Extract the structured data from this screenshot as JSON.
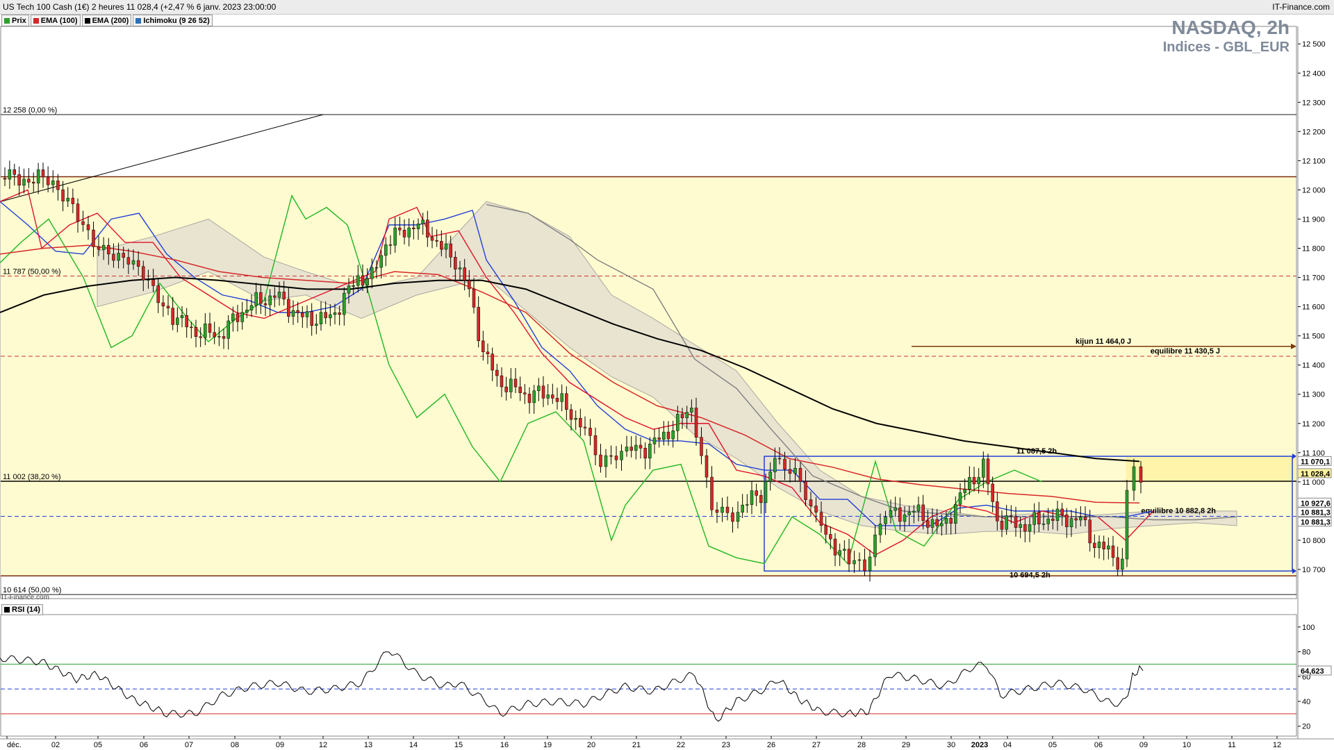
{
  "header": {
    "instrument_line": "US Tech 100 Cash (1€) 2 heures 11 028,4 (+2,47 % 6 janv. 2023 23:00:00",
    "brand": "IT-Finance.com",
    "watermark": "IT-Finance.com"
  },
  "legend": [
    {
      "label": "Prix",
      "color": "#2ca02c"
    },
    {
      "label": "EMA (100)",
      "color": "#d62728"
    },
    {
      "label": "EMA (200)",
      "color": "#000000"
    },
    {
      "label": "Ichimoku (9 26 52)",
      "color": "#2c6fb7"
    }
  ],
  "title": {
    "name": "NASDAQ, 2h",
    "sub": "Indices - GBL_EUR"
  },
  "rsi_label": "RSI (14)",
  "chart_data": [
    {
      "type": "candlestick",
      "title": "NASDAQ, 2h",
      "subtitle": "Indices - GBL_EUR",
      "x_axis_labels": [
        "déc.",
        "02",
        "05",
        "06",
        "07",
        "08",
        "09",
        "12",
        "13",
        "14",
        "15",
        "16",
        "19",
        "20",
        "21",
        "22",
        "23",
        "26",
        "27",
        "28",
        "29",
        "30",
        "2023",
        "04",
        "05",
        "06",
        "09",
        "10",
        "11",
        "12"
      ],
      "y_axis_ticks": [
        10700,
        10800,
        10900,
        11000,
        11100,
        11200,
        11300,
        11400,
        11500,
        11600,
        11700,
        11800,
        11900,
        12000,
        12100,
        12200,
        12300,
        12400,
        12500
      ],
      "y_range": [
        10600,
        12560
      ],
      "axis_tags": [
        {
          "value": 11070.1,
          "text": "11 070,1",
          "color": "#000000"
        },
        {
          "value": 11028.4,
          "text": "11 028,4",
          "color": "#000000",
          "highlight": "#fff3a0"
        },
        {
          "value": 10927.6,
          "text": "10 927,6",
          "color": "#d62728"
        },
        {
          "value": 10881.3,
          "text": "10 881,3",
          "color": "#1f3fd6"
        },
        {
          "value": 10881.3,
          "text": "10 881,3",
          "color": "#d62728"
        }
      ],
      "fibonacci": [
        {
          "value": 12258,
          "text": "12 258 (0,00 %)"
        },
        {
          "value": 11787,
          "text": "11 787 (50,00 %)"
        },
        {
          "value": 11002,
          "text": "11 002 (38,20 %)"
        },
        {
          "value": 10614,
          "text": "10 614 (50,00 %)"
        }
      ],
      "horizontal_levels": [
        {
          "value": 12045,
          "style": "solid",
          "color": "#7a2a10"
        },
        {
          "value": 11705,
          "style": "dashed",
          "color": "#c83232"
        },
        {
          "value": 11430,
          "style": "dashed",
          "color": "#c83232"
        },
        {
          "value": 11002,
          "style": "solid",
          "color": "#000000"
        },
        {
          "value": 10882,
          "style": "dashed",
          "color": "#1f3fd6"
        },
        {
          "value": 10678,
          "style": "solid",
          "color": "#7a2a10"
        }
      ],
      "shaded_zone": {
        "from": 10678,
        "to": 12045,
        "color": "#fffbd0"
      },
      "annotations": [
        {
          "text": "kijun 11 464,0 J",
          "value": 11464,
          "color": "#7a3a0a"
        },
        {
          "text": "equilibre 11 430,5 J",
          "value": 11430.5,
          "color": "#7a3a0a"
        },
        {
          "text": "equilibre 10 882,8 2h",
          "value": 10882.8,
          "color": "#1f3fd6"
        },
        {
          "text": "11 087,5 2h",
          "value": 11087.5,
          "color": "#1f3fd6"
        },
        {
          "text": "10 694,5 2h",
          "value": 10694.5,
          "color": "#1f3fd6"
        }
      ],
      "box_range": {
        "high": 11087.5,
        "low": 10694.5,
        "color": "#1f3fd6"
      },
      "trendline": {
        "from": 11960,
        "to": 12258,
        "color": "#000000"
      },
      "series": [
        {
          "name": "EMA (100)",
          "color": "#d62728",
          "values": [
            11780,
            11800,
            11810,
            11790,
            11760,
            11720,
            11700,
            11690,
            11680,
            11720,
            11710,
            11650,
            11580,
            11440,
            11340,
            11260,
            11220,
            11160,
            11080,
            11050,
            11010,
            10990,
            10975,
            10960,
            10950,
            10930,
            10927.6
          ]
        },
        {
          "name": "EMA (200)",
          "color": "#000000",
          "values": [
            11580,
            11640,
            11670,
            11690,
            11700,
            11690,
            11675,
            11660,
            11660,
            11680,
            11690,
            11690,
            11660,
            11600,
            11540,
            11490,
            11450,
            11390,
            11320,
            11250,
            11200,
            11170,
            11140,
            11120,
            11100,
            11080,
            11070.1
          ]
        }
      ],
      "close": 11028.4
    },
    {
      "type": "line",
      "title": "RSI (14)",
      "y_axis_ticks": [
        20,
        40,
        60,
        80,
        100
      ],
      "y_range": [
        12,
        110
      ],
      "levels": [
        {
          "value": 70,
          "color": "#2ca02c"
        },
        {
          "value": 50,
          "color": "#1f3fd6",
          "style": "dashed"
        },
        {
          "value": 30,
          "color": "#d62728"
        }
      ],
      "axis_tag": {
        "value": 64.623,
        "text": "64,623"
      },
      "last": 64.623
    }
  ]
}
